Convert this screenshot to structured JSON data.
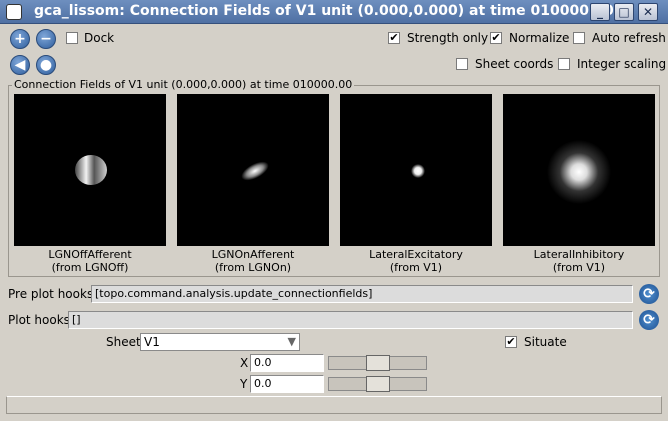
{
  "window": {
    "title": "gca_lissom: Connection Fields of V1 unit (0.000,0.000) at time 010000.00",
    "minimize": "_",
    "maximize": "□",
    "close": "✕"
  },
  "toolbar": {
    "zoom_in": "+",
    "zoom_out": "−",
    "back": "◀",
    "forward": "●",
    "dock_label": "Dock",
    "dock_checked": false,
    "strength_only_label": "Strength only",
    "strength_only_checked": true,
    "normalize_label": "Normalize",
    "normalize_checked": true,
    "auto_refresh_label": "Auto refresh",
    "auto_refresh_checked": false,
    "sheet_coords_label": "Sheet coords",
    "sheet_coords_checked": false,
    "integer_scaling_label": "Integer scaling",
    "integer_scaling_checked": false
  },
  "group": {
    "title": "Connection Fields of V1 unit (0.000,0.000) at time 010000.00"
  },
  "plots": [
    {
      "line1": "LGNOffAfferent",
      "line2": "(from LGNOff)"
    },
    {
      "line1": "LGNOnAfferent",
      "line2": "(from LGNOn)"
    },
    {
      "line1": "LateralExcitatory",
      "line2": "(from V1)"
    },
    {
      "line1": "LateralInhibitory",
      "line2": "(from V1)"
    }
  ],
  "hooks": {
    "pre_label": "Pre plot hooks",
    "pre_value": "[topo.command.analysis.update_connectionfields]",
    "plot_label": "Plot hooks",
    "plot_value": "[]"
  },
  "controls": {
    "sheet_label": "Sheet",
    "sheet_value": "V1",
    "situate_label": "Situate",
    "situate_checked": true,
    "x_label": "X",
    "x_value": "0.0",
    "x_slider": 0.5,
    "y_label": "Y",
    "y_value": "0.0",
    "y_slider": 0.5
  },
  "icons": {
    "check": "✔",
    "refresh": "⟳",
    "dropdown": "▼"
  }
}
